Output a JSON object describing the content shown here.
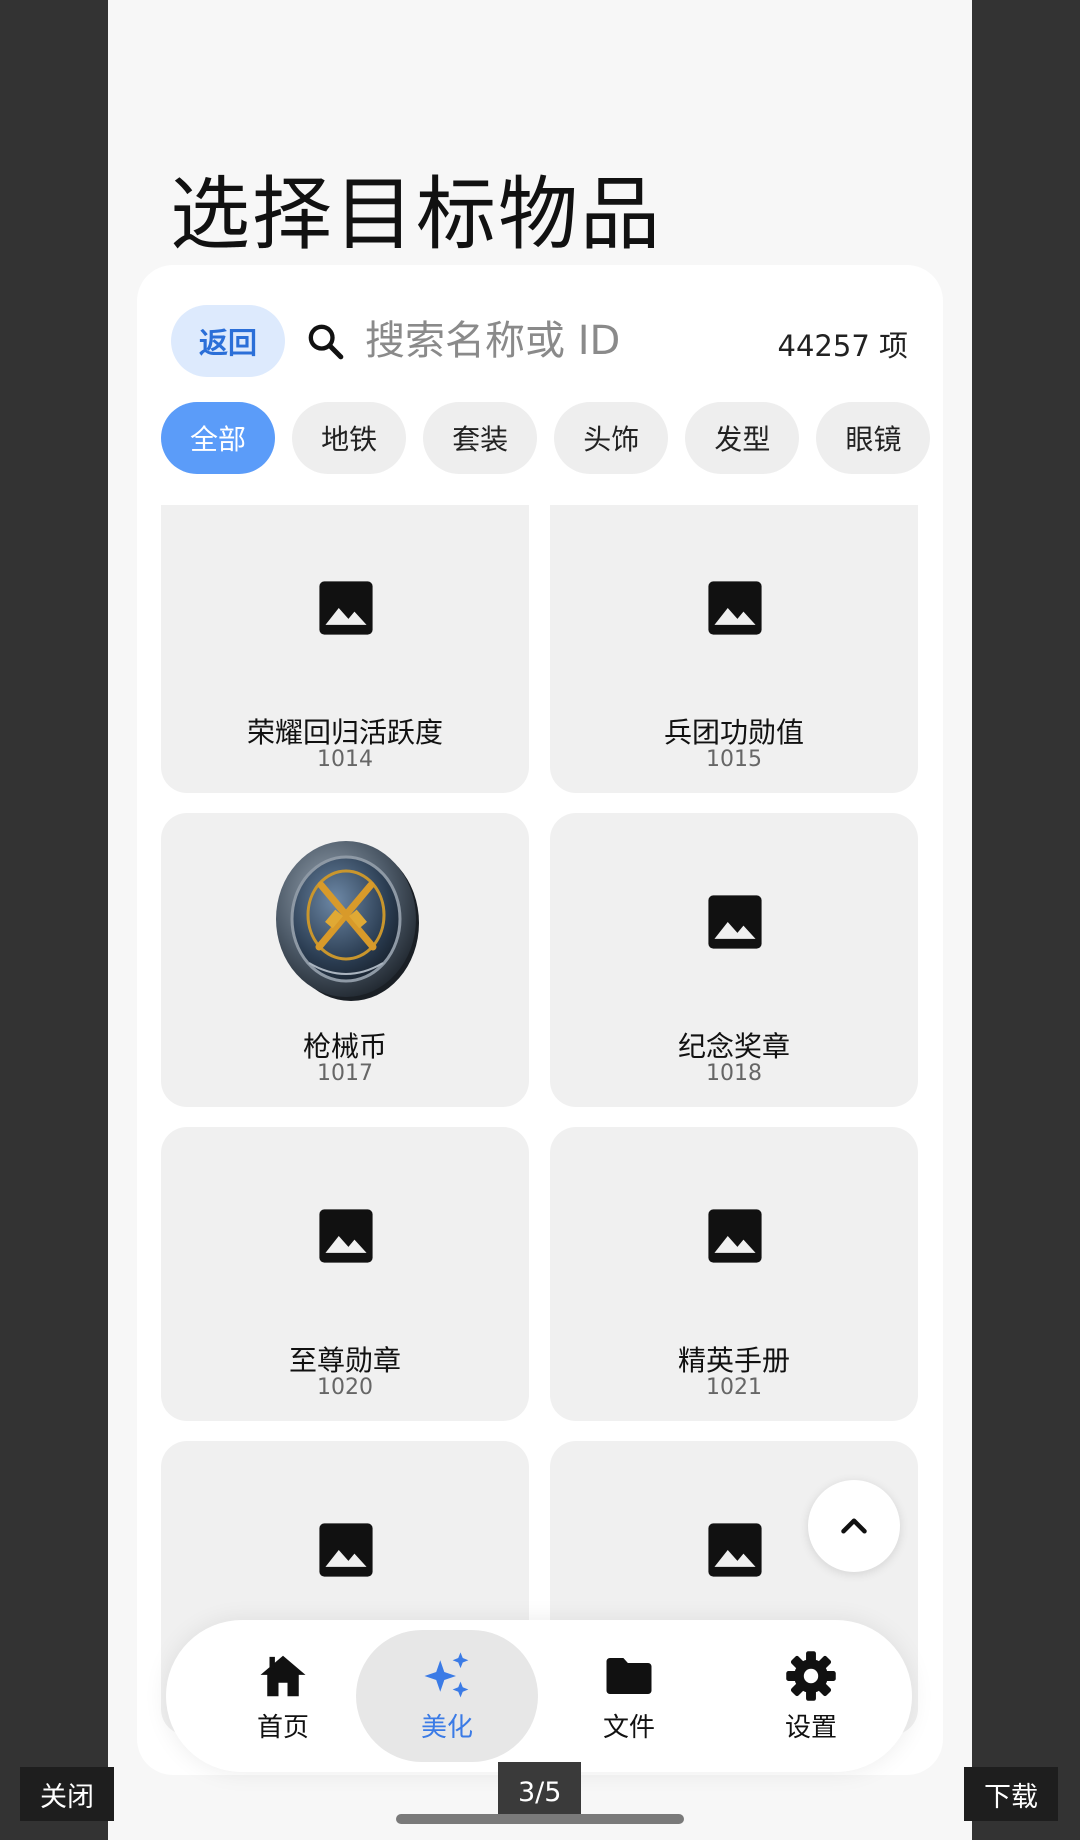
{
  "page": {
    "title": "选择目标物品"
  },
  "search": {
    "back_label": "返回",
    "placeholder": "搜索名称或 ID",
    "count": "44257 项"
  },
  "categories": [
    {
      "label": "全部",
      "active": true
    },
    {
      "label": "地铁",
      "active": false
    },
    {
      "label": "套装",
      "active": false
    },
    {
      "label": "头饰",
      "active": false
    },
    {
      "label": "发型",
      "active": false
    },
    {
      "label": "眼镜",
      "active": false
    },
    {
      "label": "",
      "active": false
    }
  ],
  "items": [
    {
      "name": "荣耀回归活跃度",
      "id": "1014",
      "icon": "image-placeholder-icon"
    },
    {
      "name": "兵团功勋值",
      "id": "1015",
      "icon": "image-placeholder-icon"
    },
    {
      "name": "枪械币",
      "id": "1017",
      "icon": "gun-coin-icon"
    },
    {
      "name": "纪念奖章",
      "id": "1018",
      "icon": "image-placeholder-icon"
    },
    {
      "name": "至尊勋章",
      "id": "1020",
      "icon": "image-placeholder-icon"
    },
    {
      "name": "精英手册",
      "id": "1021",
      "icon": "image-placeholder-icon"
    },
    {
      "name": "",
      "id": "",
      "icon": "image-placeholder-icon"
    },
    {
      "name": "",
      "id": "",
      "icon": "image-placeholder-icon"
    }
  ],
  "nav": [
    {
      "label": "首页",
      "icon": "home-icon",
      "active": false
    },
    {
      "label": "美化",
      "icon": "sparkle-icon",
      "active": true
    },
    {
      "label": "文件",
      "icon": "folder-icon",
      "active": false
    },
    {
      "label": "设置",
      "icon": "gear-icon",
      "active": false
    }
  ],
  "viewer": {
    "close_label": "关闭",
    "page_indicator": "3/5",
    "download_label": "下载"
  },
  "colors": {
    "accent": "#3b7be6",
    "chip_active": "#5b9cf9",
    "back_bg": "#ddeafd"
  }
}
